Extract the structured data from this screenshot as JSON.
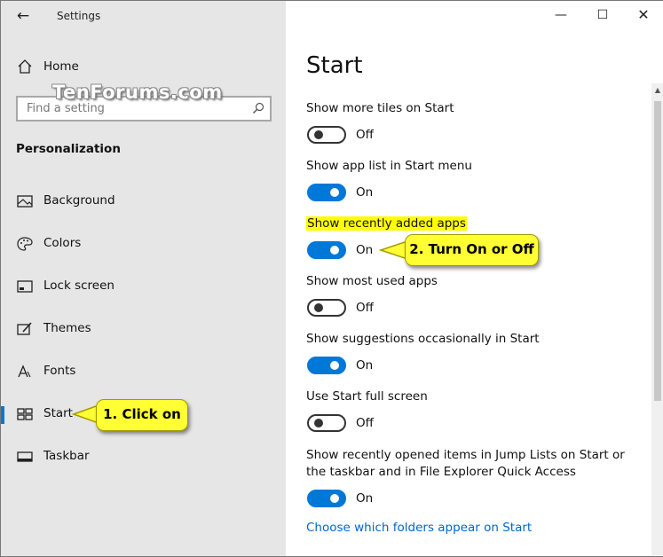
{
  "window": {
    "app_title": "Settings",
    "controls": {
      "minimize_icon": "minimize-icon",
      "maximize_icon": "maximize-icon",
      "close_icon": "close-icon"
    }
  },
  "sidebar": {
    "home_label": "Home",
    "search": {
      "placeholder": "Find a setting"
    },
    "section_title": "Personalization",
    "items": [
      {
        "label": "Background",
        "icon": "picture-icon"
      },
      {
        "label": "Colors",
        "icon": "palette-icon"
      },
      {
        "label": "Lock screen",
        "icon": "lock-screen-icon"
      },
      {
        "label": "Themes",
        "icon": "themes-icon"
      },
      {
        "label": "Fonts",
        "icon": "fonts-icon"
      },
      {
        "label": "Start",
        "icon": "start-icon",
        "selected": true
      },
      {
        "label": "Taskbar",
        "icon": "taskbar-icon"
      }
    ]
  },
  "watermark": "TenForums.com",
  "main": {
    "title": "Start",
    "settings": [
      {
        "label": "Show more tiles on Start",
        "state": "Off"
      },
      {
        "label": "Show app list in Start menu",
        "state": "On"
      },
      {
        "label": "Show recently added apps",
        "state": "On"
      },
      {
        "label": "Show most used apps",
        "state": "Off"
      },
      {
        "label": "Show suggestions occasionally in Start",
        "state": "On"
      },
      {
        "label": "Use Start full screen",
        "state": "Off"
      },
      {
        "label": "Show recently opened items in Jump Lists on Start or the taskbar and in File Explorer Quick Access",
        "state": "On"
      }
    ],
    "link": "Choose which folders appear on Start"
  },
  "callouts": {
    "click_on": "1. Click on",
    "turn_on_off": "2. Turn On or Off"
  },
  "colors": {
    "accent": "#0078d7",
    "callout": "#ffff33",
    "highlight": "#ffff00",
    "sidebar_bg": "#e6e6e6"
  }
}
